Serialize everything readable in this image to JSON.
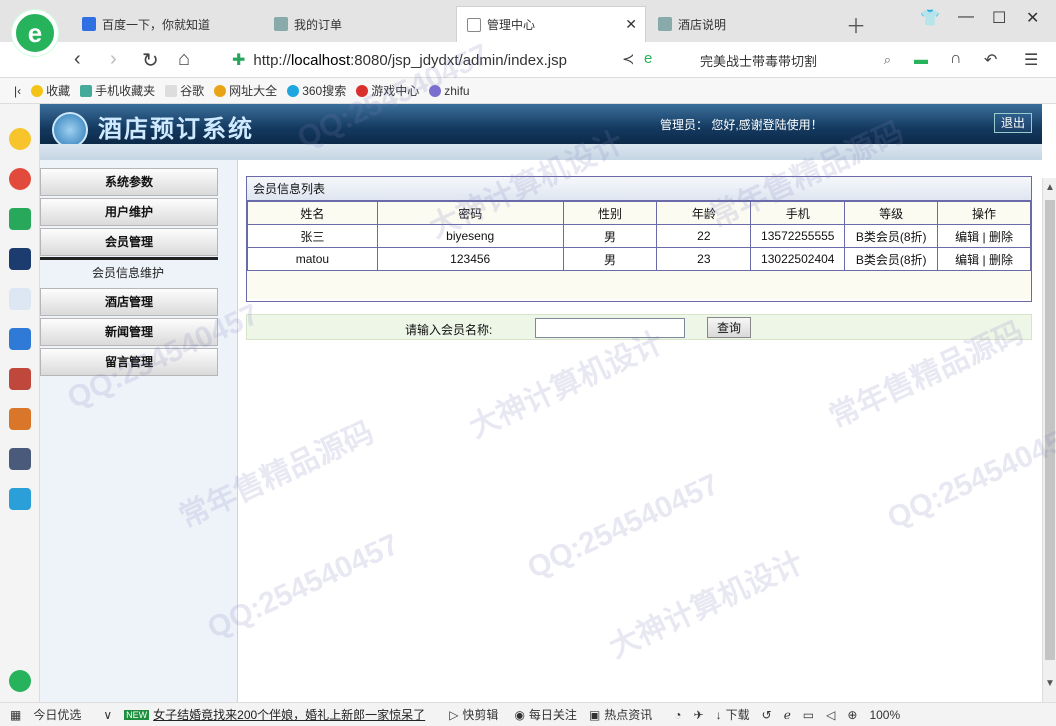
{
  "browser": {
    "tabs": [
      {
        "label": "百度一下，你就知道"
      },
      {
        "label": "我的订单"
      },
      {
        "label": "管理中心"
      },
      {
        "label": "酒店说明"
      }
    ],
    "url_prefix": "http://",
    "url_host": "localhost",
    "url_rest": ":8080/jsp_jdydxt/admin/index.jsp",
    "search_text": "完美战士带毒带切割",
    "bookmarks": [
      "收藏",
      "手机收藏夹",
      "谷歌",
      "网址大全",
      "360搜索",
      "游戏中心",
      "zhifu"
    ]
  },
  "app": {
    "title": "酒店预订系统",
    "welcome": "管理员：  您好,感谢登陆使用！",
    "logout_label": "退出"
  },
  "menu": {
    "items": [
      {
        "label": "系统参数"
      },
      {
        "label": "用户维护"
      },
      {
        "label": "会员管理"
      },
      {
        "label": "酒店管理"
      },
      {
        "label": "新闻管理"
      },
      {
        "label": "留言管理"
      }
    ],
    "sub_item": "会员信息维护"
  },
  "member_list": {
    "title": "会员信息列表",
    "columns": [
      "姓名",
      "密码",
      "性别",
      "年龄",
      "手机",
      "等级",
      "操作"
    ],
    "rows": [
      {
        "name": "张三",
        "password": "biyeseng",
        "gender": "男",
        "age": "22",
        "phone": "13572255555",
        "level": "B类会员(8折)"
      },
      {
        "name": "matou",
        "password": "123456",
        "gender": "男",
        "age": "23",
        "phone": "13022502404",
        "level": "B类会员(8折)"
      }
    ],
    "edit_label": "编辑",
    "sep": "|",
    "delete_label": "删除"
  },
  "query": {
    "label": "请输入会员名称:",
    "value": "",
    "button_label": "查询"
  },
  "statusbar": {
    "today": "今日优选",
    "badge": "NEW",
    "news": "女子结婚竟找来200个伴娘，婚礼上新郎一家惊呆了",
    "clip": "快剪辑",
    "daily": "每日关注",
    "hot": "热点资讯",
    "download": "下载",
    "zoom": "100%"
  },
  "watermarks": [
    "QQ:254540457",
    "大神计算机设计",
    "常年售精品源码"
  ],
  "colors": {
    "header": "#143a60",
    "panel_border": "#6a6aa8",
    "accent_green": "#27b25c"
  }
}
